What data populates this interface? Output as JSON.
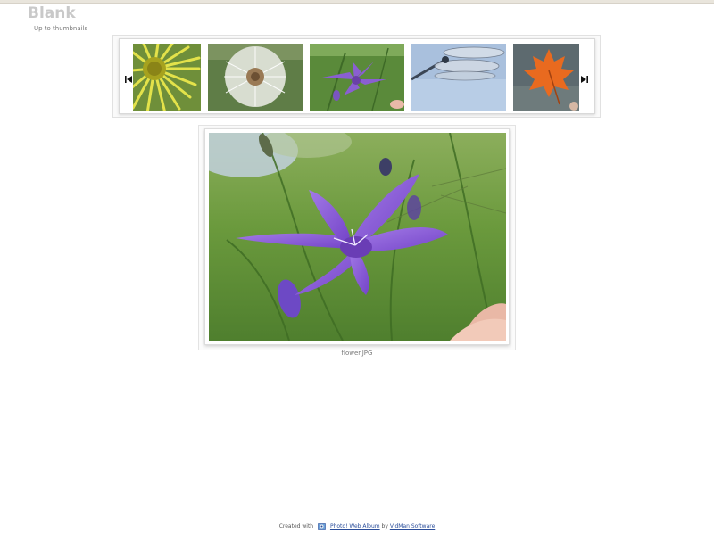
{
  "header": {
    "title": "Blank",
    "up_link": "Up to thumbnails"
  },
  "filmstrip": {
    "prev_icon": "skip-to-first-icon",
    "next_icon": "skip-to-last-icon",
    "thumbnails": [
      {
        "subject": "yellow-daisy"
      },
      {
        "subject": "dandelion-seedhead"
      },
      {
        "subject": "purple-bellflower",
        "selected": true
      },
      {
        "subject": "dragonfly-wings"
      },
      {
        "subject": "orange-maple-leaf"
      }
    ]
  },
  "viewer": {
    "caption": "flower.JPG"
  },
  "footer": {
    "created_with": "Created with",
    "app_link": "Photo! Web Album",
    "by": "by",
    "vendor_link": "VidMan Software"
  },
  "colors": {
    "title": "#c9c9c9",
    "link": "#2a4d9a",
    "background": "#ffffff"
  }
}
